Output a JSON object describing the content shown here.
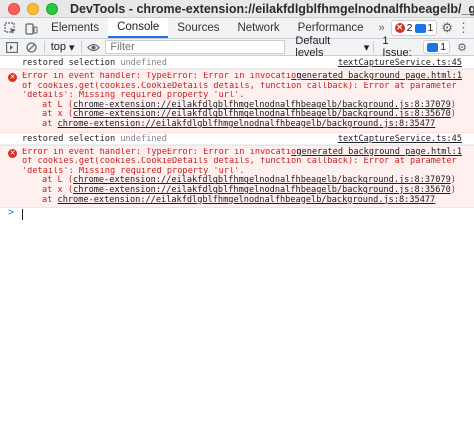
{
  "window": {
    "title": "DevTools - chrome-extension://eilakfdlgblfhmgelnodnalfhbeagelb/_generated_backgro..."
  },
  "tabs": {
    "items": [
      {
        "label": "Elements"
      },
      {
        "label": "Console"
      },
      {
        "label": "Sources"
      },
      {
        "label": "Network"
      },
      {
        "label": "Performance"
      }
    ],
    "more": "»",
    "error_count": "2",
    "message_count": "1"
  },
  "toolbar": {
    "context": "top",
    "filter_placeholder": "Filter",
    "levels": "Default levels",
    "issues_label": "1 Issue:",
    "issues_count": "1"
  },
  "console": {
    "messages": [
      {
        "type": "info",
        "text": "restored selection",
        "value": "undefined",
        "source": "textCaptureService.ts:45"
      },
      {
        "type": "error",
        "source": "_generated_background_page.html:1",
        "lines": [
          "Error in event handler: TypeError: Error in invocation",
          "of cookies.get(cookies.CookieDetails details, function callback): Error at parameter",
          "'details': Missing required property 'url'."
        ],
        "stack": [
          {
            "prefix": "at L (",
            "link": "chrome-extension://eilakfdlgblfhmgelnodnalfhbeagelb/background.js:8:37079",
            "suffix": ")"
          },
          {
            "prefix": "at x (",
            "link": "chrome-extension://eilakfdlgblfhmgelnodnalfhbeagelb/background.js:8:35670",
            "suffix": ")"
          },
          {
            "prefix": "at ",
            "link": "chrome-extension://eilakfdlgblfhmgelnodnalfhbeagelb/background.js:8:35477",
            "suffix": ""
          }
        ]
      },
      {
        "type": "info",
        "text": "restored selection",
        "value": "undefined",
        "source": "textCaptureService.ts:45"
      },
      {
        "type": "error",
        "source": "_generated_background_page.html:1",
        "lines": [
          "Error in event handler: TypeError: Error in invocation",
          "of cookies.get(cookies.CookieDetails details, function callback): Error at parameter",
          "'details': Missing required property 'url'."
        ],
        "stack": [
          {
            "prefix": "at L (",
            "link": "chrome-extension://eilakfdlgblfhmgelnodnalfhbeagelb/background.js:8:37079",
            "suffix": ")"
          },
          {
            "prefix": "at x (",
            "link": "chrome-extension://eilakfdlgblfhmgelnodnalfhbeagelb/background.js:8:35670",
            "suffix": ")"
          },
          {
            "prefix": "at ",
            "link": "chrome-extension://eilakfdlgblfhmgelnodnalfhbeagelb/background.js:8:35477",
            "suffix": ""
          }
        ]
      }
    ],
    "prompt_symbol": ">"
  },
  "colors": {
    "accent": "#1a73e8",
    "error_text": "#c5221f",
    "error_bg": "#fff0f0"
  },
  "icons": {
    "inspect": "inspect-icon",
    "device": "device-toolbar-icon",
    "sidebar": "console-sidebar-icon",
    "clear": "clear-console-icon",
    "eye": "live-expression-icon",
    "settings": "gear-icon",
    "menu": "kebab-menu-icon"
  }
}
